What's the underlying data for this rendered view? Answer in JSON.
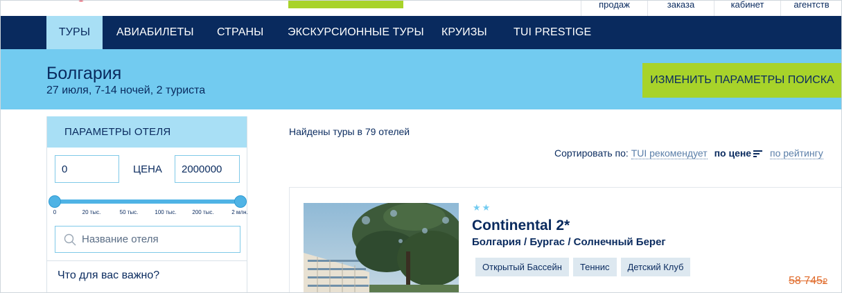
{
  "topbar": {
    "util_links": [
      "продаж",
      "заказа",
      "кабинет",
      "агентств"
    ]
  },
  "nav": {
    "items": [
      "ТУРЫ",
      "АВИАБИЛЕТЫ",
      "СТРАНЫ",
      "ЭКСКУРСИОННЫЕ ТУРЫ",
      "КРУИЗЫ",
      "TUI PRESTIGE"
    ],
    "active_index": 0
  },
  "banner": {
    "title": "Болгария",
    "subtitle": "27 июля, 7-14 ночей, 2 туриста",
    "change_button": "ИЗМЕНИТЬ ПАРАМЕТРЫ ПОИСКА"
  },
  "sidebar": {
    "header": "ПАРАМЕТРЫ ОТЕЛЯ",
    "price_min": "0",
    "price_label": "ЦЕНА",
    "price_max": "2000000",
    "slider_ticks": [
      "0",
      "20 тыс.",
      "50 тыс.",
      "100 тыс.",
      "200 тыс.",
      "2 млн."
    ],
    "hotel_name_placeholder": "Название отеля",
    "important_label": "Что для вас важно?"
  },
  "results": {
    "found_text": "Найдены туры в 79 отелей",
    "sort_label": "Сортировать по:",
    "sort_options": [
      "TUI рекомендует",
      "по цене",
      "по рейтингу"
    ],
    "active_sort": "по цене"
  },
  "hotel_card": {
    "stars": "★★",
    "name": "Continental 2*",
    "location": "Болгария / Бургас / Солнечный Берег",
    "tags": [
      "Открытый Бассейн",
      "Теннис",
      "Детский Клуб"
    ],
    "old_price": "58 745",
    "currency": "₽"
  },
  "colors": {
    "navy": "#092a5e",
    "sky": "#72cbf0",
    "light_sky": "#a8dff5",
    "lime": "#a8d32a",
    "accent_orange": "#e06b2b"
  }
}
